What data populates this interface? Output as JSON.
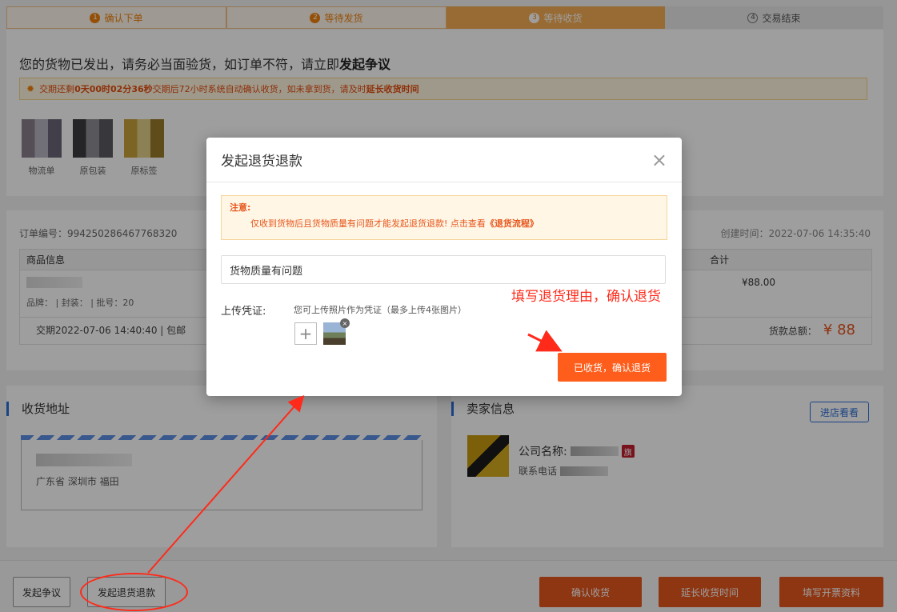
{
  "steps": [
    {
      "num": "1",
      "label": "确认下单"
    },
    {
      "num": "2",
      "label": "等待发货"
    },
    {
      "num": "3",
      "label": "等待收货"
    },
    {
      "num": "4",
      "label": "交易结束"
    }
  ],
  "status": {
    "headline_prefix": "您的货物已发出，请务必当面验货，如订单不符，请立即",
    "headline_strong": "发起争议",
    "notice_prefix": "交期还剩",
    "notice_time": "0天00时02分36秒",
    "notice_middle": "交期后72小时系统自动确认收货，如未拿到货，请及时",
    "notice_link": "延长收货时间"
  },
  "thumbs": [
    {
      "label": "物流单"
    },
    {
      "label": "原包装"
    },
    {
      "label": "原标签"
    }
  ],
  "order": {
    "number_label": "订单编号：994250286467768320",
    "created": "创建时间：2022-07-06 14:35:40",
    "col_info": "商品信息",
    "col_total": "合计",
    "attrs": "品牌：      |  封装：          |  批号：20",
    "price": "¥88.00",
    "delivery": "交期2022-07-06 14:40:40 | 包邮",
    "total_label": "货款总额：",
    "total_value": "¥ 88"
  },
  "address": {
    "title": "收货地址",
    "text": "广东省 深圳市 福田"
  },
  "seller": {
    "title": "卖家信息",
    "visit_btn": "进店看看",
    "company_label": "公司名称:",
    "phone_label": "联系电话",
    "flag": "旗"
  },
  "bottom": {
    "dispute": "发起争议",
    "refund": "发起退货退款",
    "confirm": "确认收货",
    "extend": "延长收货时间",
    "invoice": "填写开票资料"
  },
  "modal": {
    "title": "发起退货退款",
    "close": "×",
    "warn_title": "注意:",
    "warn_body": "仅收到货物后且货物质量有问题才能发起退货退款! 点击查看",
    "warn_link": "《退货流程》",
    "reason_value": "货物质量有问题",
    "upload_label": "上传凭证:",
    "upload_hint": "您可上传照片作为凭证（最多上传4张图片）",
    "add": "+",
    "delete_badge": "×",
    "confirm_btn": "已收货，确认退货"
  },
  "annotation": "填写退货理由，确认退货",
  "colors": {
    "accent": "#e6561c",
    "brand_blue": "#2d6fd6",
    "annotation_red": "#ff2a1a"
  }
}
